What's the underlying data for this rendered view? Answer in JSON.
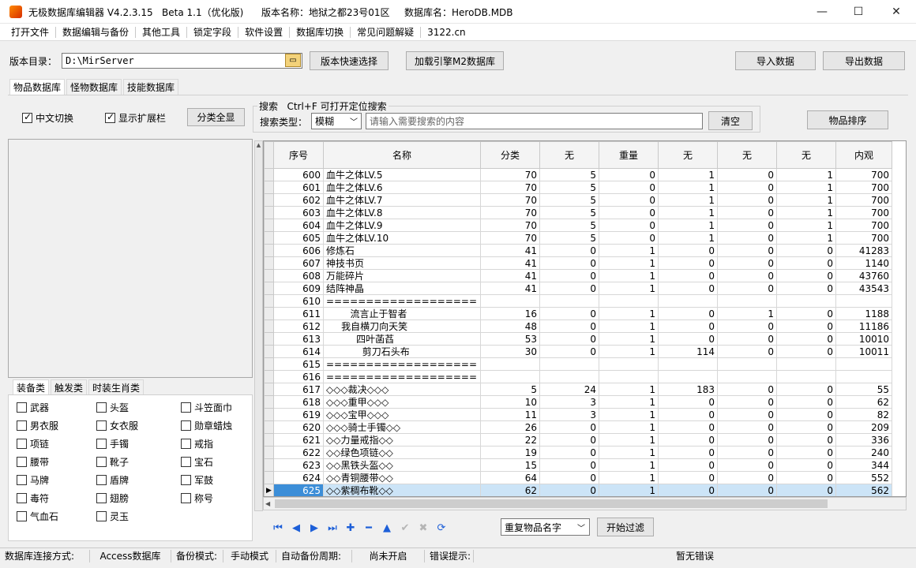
{
  "title_bar": {
    "app": "无极数据库编辑器 V4.2.3.15",
    "beta": "Beta 1.1（优化版)",
    "version_name": "版本名称：地狱之都23号01区",
    "db_name": "数据库名：HeroDB.MDB",
    "minimize": "—",
    "maximize": "☐",
    "close": "✕"
  },
  "menu": [
    "打开文件",
    "数据编辑与备份",
    "其他工具",
    "锁定字段",
    "软件设置",
    "数据库切换",
    "常见问题解疑",
    "3122.cn"
  ],
  "toolbar": {
    "dir_label": "版本目录：",
    "dir_value": "D:\\MirServer",
    "folder_icon": "folder-icon",
    "quick_select": "版本快速选择",
    "load_m2": "加载引擎M2数据库",
    "import": "导入数据",
    "export": "导出数据"
  },
  "tabs": [
    "物品数据库",
    "怪物数据库",
    "技能数据库"
  ],
  "options": {
    "chinese_switch": "中文切换",
    "chinese_switch_checked": true,
    "show_ext": "显示扩展栏",
    "show_ext_checked": true,
    "show_all_categories": "分类全显"
  },
  "search": {
    "group_title": "搜索   Ctrl+F 可打开定位搜索",
    "type_label": "搜索类型：",
    "type_value": "模糊",
    "placeholder": "请输入需要搜索的内容",
    "clear": "清空",
    "sort": "物品排序"
  },
  "category_tabs": [
    "装备类",
    "触发类",
    "时装生肖类"
  ],
  "categories": [
    [
      "武器",
      "头盔",
      "斗笠面巾"
    ],
    [
      "男衣服",
      "女衣服",
      "勋章蜡烛"
    ],
    [
      "项链",
      "手镯",
      "戒指"
    ],
    [
      "腰带",
      "靴子",
      "宝石"
    ],
    [
      "马牌",
      "盾牌",
      "军鼓"
    ],
    [
      "毒符",
      "翅膀",
      "称号"
    ],
    [
      "气血石",
      "灵玉",
      ""
    ]
  ],
  "grid": {
    "columns": [
      "序号",
      "名称",
      "分类",
      "无",
      "重量",
      "无",
      "无",
      "无",
      "内观"
    ],
    "rows": [
      [
        "600",
        "血牛之体LV.5",
        "70",
        "5",
        "0",
        "1",
        "0",
        "1",
        "700"
      ],
      [
        "601",
        "血牛之体LV.6",
        "70",
        "5",
        "0",
        "1",
        "0",
        "1",
        "700"
      ],
      [
        "602",
        "血牛之体LV.7",
        "70",
        "5",
        "0",
        "1",
        "0",
        "1",
        "700"
      ],
      [
        "603",
        "血牛之体LV.8",
        "70",
        "5",
        "0",
        "1",
        "0",
        "1",
        "700"
      ],
      [
        "604",
        "血牛之体LV.9",
        "70",
        "5",
        "0",
        "1",
        "0",
        "1",
        "700"
      ],
      [
        "605",
        "血牛之体LV.10",
        "70",
        "5",
        "0",
        "1",
        "0",
        "1",
        "700"
      ],
      [
        "606",
        "修炼石",
        "41",
        "0",
        "1",
        "0",
        "0",
        "0",
        "41283"
      ],
      [
        "607",
        "神技书页",
        "41",
        "0",
        "1",
        "0",
        "0",
        "0",
        "1140"
      ],
      [
        "608",
        "万能碎片",
        "41",
        "0",
        "1",
        "0",
        "0",
        "0",
        "43760"
      ],
      [
        "609",
        "结阵神晶",
        "41",
        "0",
        "1",
        "0",
        "0",
        "0",
        "43543"
      ],
      [
        "610",
        "===================",
        "",
        "",
        "",
        "",
        "",
        "",
        ""
      ],
      [
        "611",
        "        流言止于智者",
        "16",
        "0",
        "1",
        "0",
        "1",
        "0",
        "1188"
      ],
      [
        "612",
        "     我自横刀向天笑",
        "48",
        "0",
        "1",
        "0",
        "0",
        "0",
        "11186"
      ],
      [
        "613",
        "          四叶菡萏",
        "53",
        "0",
        "1",
        "0",
        "0",
        "0",
        "10010"
      ],
      [
        "614",
        "            剪刀石头布",
        "30",
        "0",
        "1",
        "114",
        "0",
        "0",
        "10011"
      ],
      [
        "615",
        "===================",
        "",
        "",
        "",
        "",
        "",
        "",
        ""
      ],
      [
        "616",
        "===================",
        "",
        "",
        "",
        "",
        "",
        "",
        ""
      ],
      [
        "617",
        "◇◇◇裁决◇◇◇",
        "5",
        "24",
        "1",
        "183",
        "0",
        "0",
        "55"
      ],
      [
        "618",
        "◇◇◇重甲◇◇◇",
        "10",
        "3",
        "1",
        "0",
        "0",
        "0",
        "62"
      ],
      [
        "619",
        "◇◇◇宝甲◇◇◇",
        "11",
        "3",
        "1",
        "0",
        "0",
        "0",
        "82"
      ],
      [
        "620",
        "◇◇◇骑士手镯◇◇",
        "26",
        "0",
        "1",
        "0",
        "0",
        "0",
        "209"
      ],
      [
        "621",
        "◇◇力量戒指◇◇",
        "22",
        "0",
        "1",
        "0",
        "0",
        "0",
        "336"
      ],
      [
        "622",
        "◇◇绿色项链◇◇",
        "19",
        "0",
        "1",
        "0",
        "0",
        "0",
        "240"
      ],
      [
        "623",
        "◇◇黑铁头盔◇◇",
        "15",
        "0",
        "1",
        "0",
        "0",
        "0",
        "344"
      ],
      [
        "624",
        "◇◇青铜腰带◇◇",
        "64",
        "0",
        "1",
        "0",
        "0",
        "0",
        "552"
      ],
      [
        "625",
        "◇◇紫稠布靴◇◇",
        "62",
        "0",
        "1",
        "0",
        "0",
        "0",
        "562"
      ]
    ],
    "selected_row": 25
  },
  "nav": {
    "icons": [
      "first-icon",
      "prev-icon",
      "next-icon",
      "last-icon",
      "add-icon",
      "delete-icon",
      "up-icon",
      "confirm-icon",
      "cancel-icon",
      "refresh-icon"
    ],
    "filter_value": "重复物品名字",
    "filter_button": "开始过滤"
  },
  "status": {
    "conn_label": "数据库连接方式:",
    "conn_value": "Access数据库",
    "backup_label": "备份模式:",
    "backup_value": "手动模式",
    "auto_label": "自动备份周期:",
    "auto_value": "尚未开启",
    "err_label": "错误提示:",
    "err_value": "暂无错误"
  }
}
